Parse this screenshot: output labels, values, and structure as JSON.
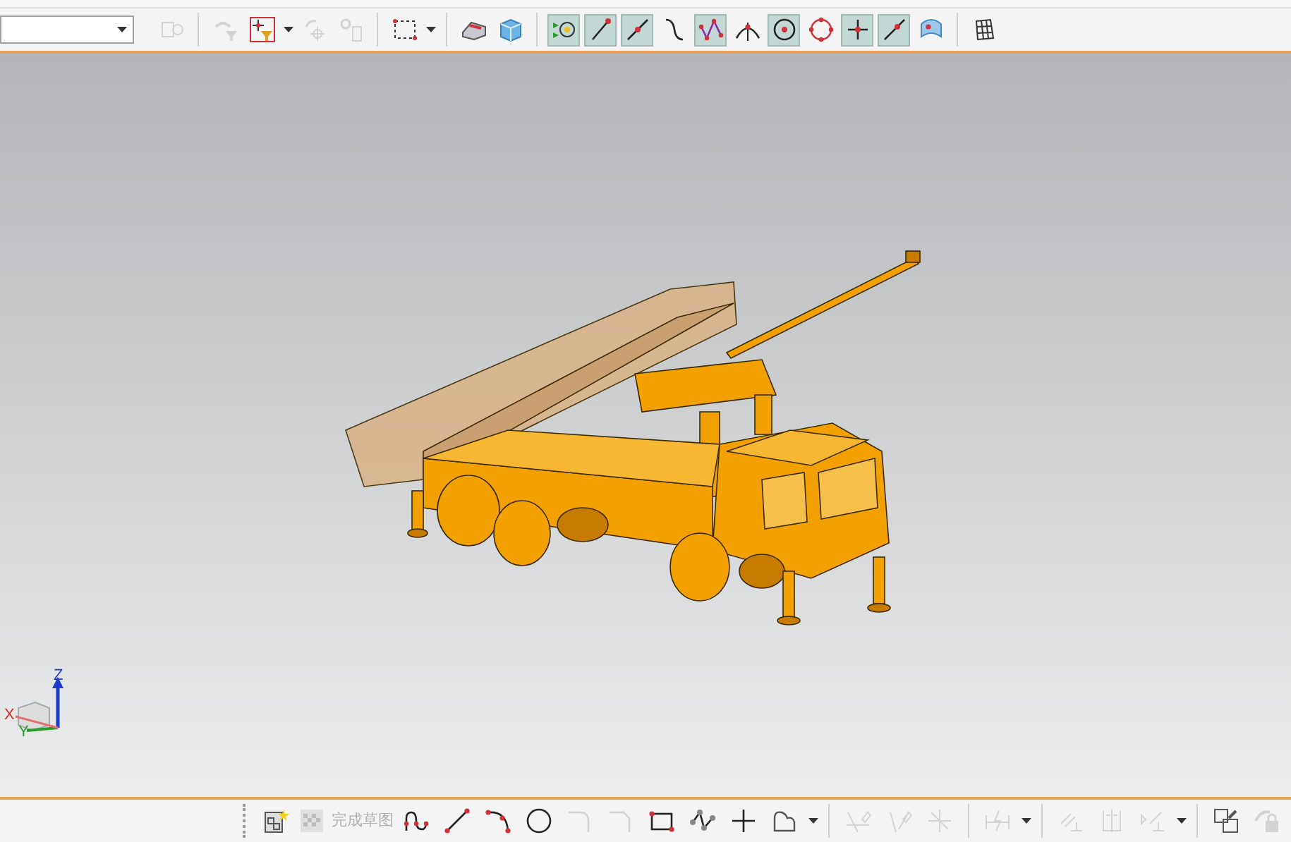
{
  "top_toolbar": {
    "items": [
      {
        "kind": "part-filter",
        "disabled": true,
        "selected": false
      },
      {
        "kind": "sep"
      },
      {
        "kind": "undo-filter",
        "disabled": true,
        "selected": false
      },
      {
        "kind": "filter",
        "disabled": false,
        "selected": false,
        "caret": true
      },
      {
        "kind": "snap-rotate",
        "disabled": true,
        "selected": false
      },
      {
        "kind": "snap-link",
        "disabled": true,
        "selected": false
      },
      {
        "kind": "sep"
      },
      {
        "kind": "box-select",
        "disabled": false,
        "selected": false,
        "caret": true
      },
      {
        "kind": "sep"
      },
      {
        "kind": "eraser",
        "disabled": false,
        "selected": false
      },
      {
        "kind": "cube",
        "disabled": false,
        "selected": false
      },
      {
        "kind": "sep"
      },
      {
        "kind": "point-snap",
        "disabled": false,
        "selected": true
      },
      {
        "kind": "line-end",
        "disabled": false,
        "selected": true
      },
      {
        "kind": "line-mid",
        "disabled": false,
        "selected": true
      },
      {
        "kind": "curve",
        "disabled": false,
        "selected": false
      },
      {
        "kind": "control-points",
        "disabled": false,
        "selected": true
      },
      {
        "kind": "intersection",
        "disabled": false,
        "selected": false
      },
      {
        "kind": "circle-center",
        "disabled": false,
        "selected": true
      },
      {
        "kind": "quadrant",
        "disabled": false,
        "selected": false
      },
      {
        "kind": "crosshair",
        "disabled": false,
        "selected": true
      },
      {
        "kind": "line-point",
        "disabled": false,
        "selected": true
      },
      {
        "kind": "face",
        "disabled": false,
        "selected": false
      },
      {
        "kind": "sep"
      },
      {
        "kind": "grid",
        "disabled": false,
        "selected": false
      }
    ]
  },
  "triad": {
    "x": "X",
    "y": "Y",
    "z": "Z"
  },
  "sketch_toolbar": {
    "items": [
      {
        "kind": "sketch-new",
        "disabled": false
      },
      {
        "kind": "finish",
        "disabled": true,
        "label": "完成草图"
      },
      {
        "kind": "profile",
        "disabled": false
      },
      {
        "kind": "line",
        "disabled": false
      },
      {
        "kind": "arc",
        "disabled": false
      },
      {
        "kind": "circle",
        "disabled": false
      },
      {
        "kind": "fillet",
        "disabled": true
      },
      {
        "kind": "chamfer",
        "disabled": true
      },
      {
        "kind": "rectangle",
        "disabled": false
      },
      {
        "kind": "polygon",
        "disabled": false
      },
      {
        "kind": "point",
        "disabled": false
      },
      {
        "kind": "offset",
        "disabled": false,
        "caret": true
      },
      {
        "kind": "sep"
      },
      {
        "kind": "trim",
        "disabled": true
      },
      {
        "kind": "extend",
        "disabled": true
      },
      {
        "kind": "corner",
        "disabled": true
      },
      {
        "kind": "sep"
      },
      {
        "kind": "dimension",
        "disabled": true,
        "caret": true
      },
      {
        "kind": "sep"
      },
      {
        "kind": "parallel",
        "disabled": true
      },
      {
        "kind": "symmetric",
        "disabled": true
      },
      {
        "kind": "constraint",
        "disabled": true,
        "caret": true
      },
      {
        "kind": "sep"
      },
      {
        "kind": "view-sketch",
        "disabled": false
      },
      {
        "kind": "lock",
        "disabled": true
      }
    ]
  }
}
